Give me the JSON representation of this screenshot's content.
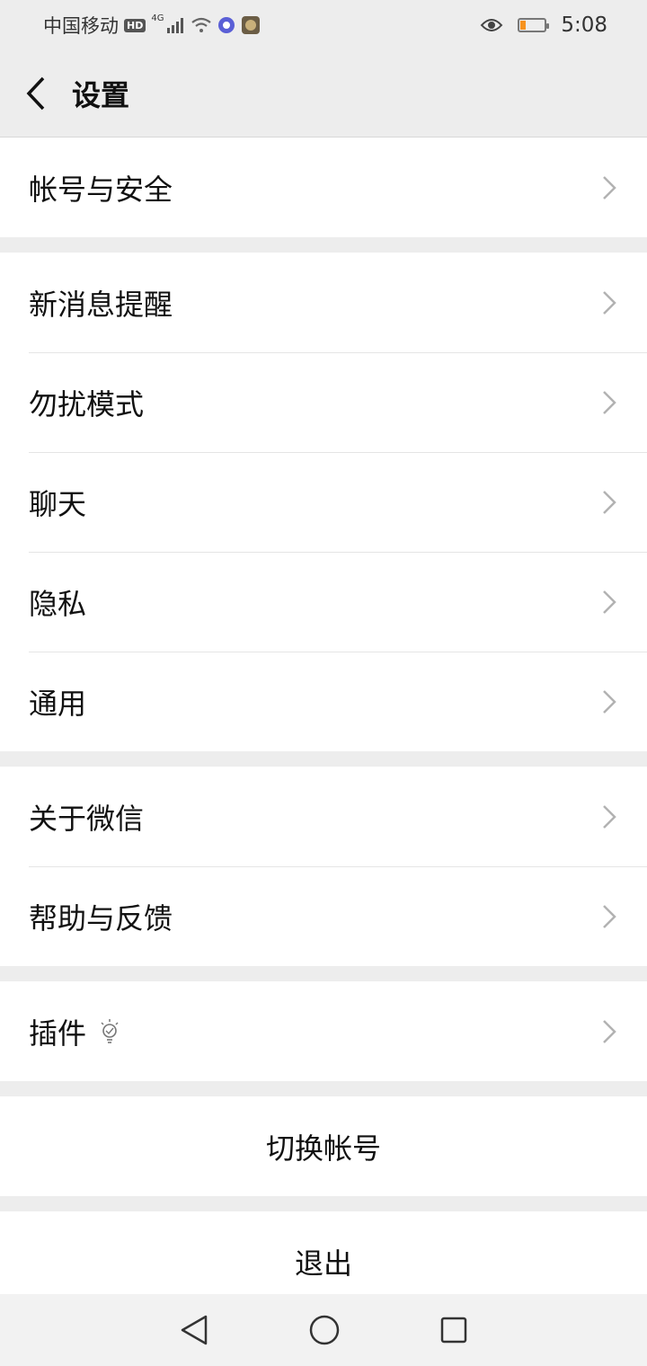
{
  "status": {
    "carrier": "中国移动",
    "hd_badge": "HD",
    "network": "4G",
    "time": "5:08",
    "battery_level": 0.15,
    "battery_color": "#f7931e"
  },
  "header": {
    "title": "设置"
  },
  "groups": [
    {
      "items": [
        {
          "label": "帐号与安全"
        }
      ]
    },
    {
      "items": [
        {
          "label": "新消息提醒"
        },
        {
          "label": "勿扰模式"
        },
        {
          "label": "聊天"
        },
        {
          "label": "隐私"
        },
        {
          "label": "通用"
        }
      ]
    },
    {
      "items": [
        {
          "label": "关于微信"
        },
        {
          "label": "帮助与反馈"
        }
      ]
    },
    {
      "items": [
        {
          "label": "插件"
        }
      ]
    }
  ],
  "actions": {
    "switch_account": "切换帐号",
    "logout": "退出"
  },
  "icons": {
    "back": "chevron-left-icon",
    "row_arrow": "chevron-right-icon",
    "plugin_hint": "lightbulb-icon",
    "sys_back": "triangle-back-icon",
    "sys_home": "circle-home-icon",
    "sys_recent": "square-recent-icon"
  },
  "colors": {
    "background": "#ededed",
    "card": "#ffffff",
    "text": "#111111",
    "chevron": "#b2b2b2"
  }
}
